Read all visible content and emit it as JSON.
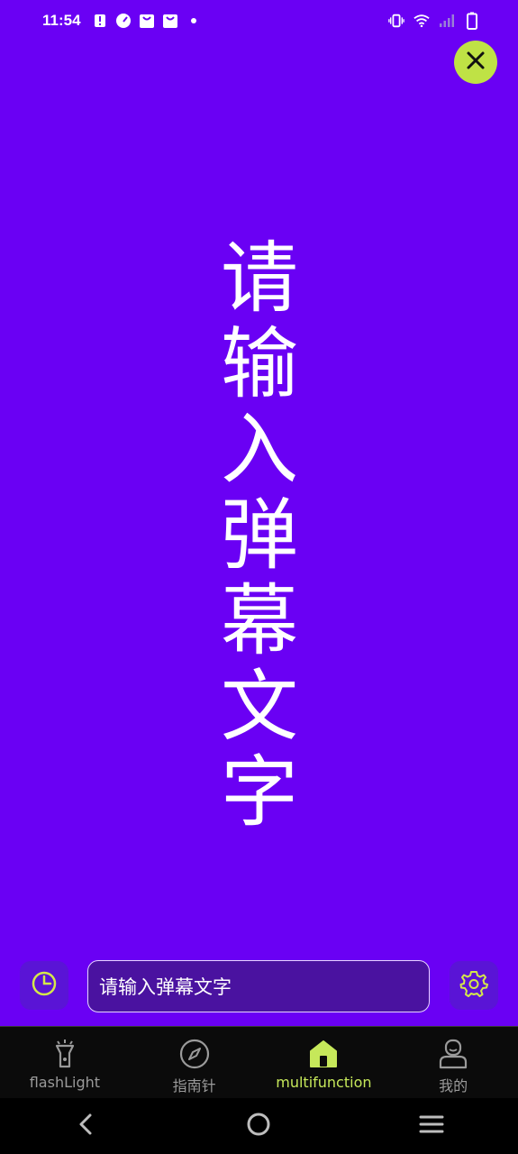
{
  "status_bar": {
    "time": "11:54",
    "left_icons": [
      "alert-icon",
      "speed-icon",
      "bag-icon",
      "bag-icon",
      "dot-icon"
    ],
    "right_icons": [
      "vibrate-icon",
      "wifi-icon",
      "signal-icon",
      "battery-icon"
    ]
  },
  "banner": {
    "text_chars": [
      "请",
      "输",
      "入",
      "弹",
      "幕",
      "文",
      "字"
    ],
    "text_color": "#ffffff",
    "background": "#6a00f4"
  },
  "close_button": {
    "icon": "close-icon",
    "color": "#bfe245"
  },
  "controls": {
    "timer_icon": "timer-icon",
    "input_value": "请输入弹幕文字",
    "settings_icon": "gear-icon"
  },
  "tabs": [
    {
      "label": "flashLight",
      "icon": "flashlight-icon",
      "active": false
    },
    {
      "label": "指南针",
      "icon": "compass-icon",
      "active": false
    },
    {
      "label": "multifunction",
      "icon": "home-icon",
      "active": true
    },
    {
      "label": "我的",
      "icon": "profile-icon",
      "active": false
    }
  ],
  "accent_color": "#c6e85a",
  "nav": [
    "back-icon",
    "home-circle-icon",
    "menu-icon"
  ]
}
